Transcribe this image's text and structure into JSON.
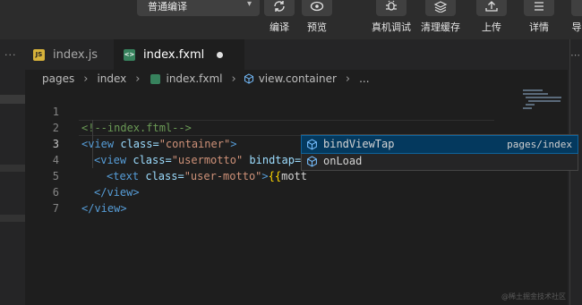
{
  "toolbar": {
    "compile_mode": "普通编译",
    "buttons": [
      {
        "label": "编译",
        "icon": "refresh-icon"
      },
      {
        "label": "预览",
        "icon": "eye-icon"
      },
      {
        "label": "真机调试",
        "icon": "bug-icon"
      },
      {
        "label": "清理缓存",
        "icon": "layers-icon"
      },
      {
        "label": "上传",
        "icon": "upload-icon"
      },
      {
        "label": "详情",
        "icon": "menu-icon"
      },
      {
        "label": "导",
        "icon": "partial-icon"
      }
    ]
  },
  "tabs": [
    {
      "label": "index.js",
      "icon": "js-file-icon",
      "active": false
    },
    {
      "label": "index.fxml",
      "icon": "fxml-file-icon",
      "active": true,
      "unsaved": true
    }
  ],
  "breadcrumb": [
    "pages",
    "index",
    "index.fxml",
    "view.container",
    "..."
  ],
  "editor": {
    "line_numbers": [
      "1",
      "2",
      "3",
      "4",
      "5",
      "6",
      "7"
    ],
    "line1": {
      "comment": "<!--index.ftml-->"
    },
    "line2": {
      "open": "<view",
      "attr": " class=",
      "value": "\"container\"",
      "close": ">"
    },
    "line3": {
      "open": "<view",
      "attr1": " class=",
      "value1": "\"usermotto\"",
      "attr2": " bindtap=",
      "q1": "\"",
      "q2": "\"",
      "close": ">"
    },
    "line4": {
      "open": "<text",
      "attr": " class=",
      "value": "\"user-motto\"",
      "close": ">",
      "braces": "{{",
      "expr": "mott"
    },
    "line5": {
      "close": "</view>"
    },
    "line6": {
      "close": "</view>"
    }
  },
  "suggestions": [
    {
      "name": "bindViewTap",
      "detail": "pages/index",
      "selected": true,
      "icon": "cube-icon"
    },
    {
      "name": "onLoad",
      "detail": "",
      "selected": false,
      "icon": "cube-icon"
    }
  ],
  "watermark": "@稀土掘金技术社区",
  "colors": {
    "accent": "#04395e",
    "background": "#1e1e1e",
    "toolbar": "#2c2c2c"
  }
}
